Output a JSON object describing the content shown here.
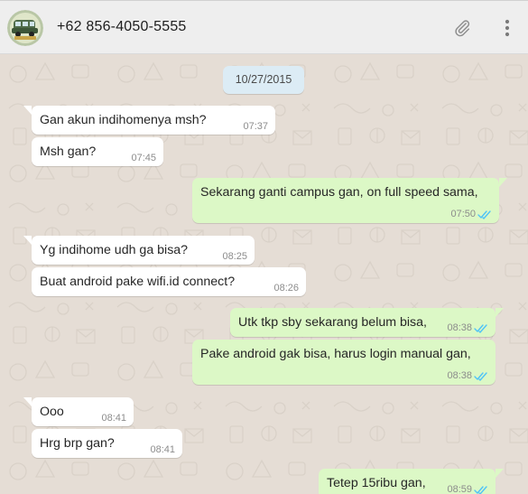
{
  "header": {
    "contact_name": "+62 856-4050-5555",
    "attach_icon": "paperclip-icon",
    "menu_icon": "kebab-menu-icon"
  },
  "colors": {
    "incoming_bubble": "#ffffff",
    "outgoing_bubble": "#dcf8c6",
    "date_chip": "#dcecf5",
    "read_ticks": "#4fc3f7",
    "chat_background": "#e5ddd5",
    "header_background": "#eeeeee"
  },
  "chat": {
    "date": "10/27/2015",
    "messages": [
      {
        "direction": "in",
        "text": "Gan akun indihomenya msh?",
        "time": "07:37"
      },
      {
        "direction": "in",
        "text": "Msh gan?",
        "time": "07:45"
      },
      {
        "direction": "out",
        "text": "Sekarang ganti campus gan, on full speed sama,",
        "time": "07:50",
        "status": "read"
      },
      {
        "direction": "in",
        "text": "Yg indihome udh ga bisa?",
        "time": "08:25"
      },
      {
        "direction": "in",
        "text": "Buat android pake wifi.id connect?",
        "time": "08:26"
      },
      {
        "direction": "out",
        "text": "Utk tkp sby sekarang belum bisa,",
        "time": "08:38",
        "status": "read"
      },
      {
        "direction": "out",
        "text": "Pake android gak bisa, harus login manual gan,",
        "time": "08:38",
        "status": "read"
      },
      {
        "direction": "in",
        "text": "Ooo",
        "time": "08:41"
      },
      {
        "direction": "in",
        "text": "Hrg brp gan?",
        "time": "08:41"
      },
      {
        "direction": "out",
        "text": "Tetep 15ribu gan,",
        "time": "08:59",
        "status": "read"
      }
    ]
  }
}
